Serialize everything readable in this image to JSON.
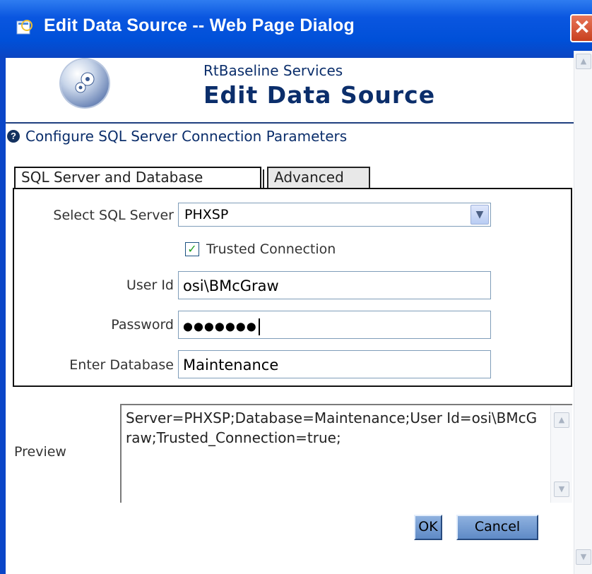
{
  "window": {
    "title": "Edit Data Source -- Web Page Dialog",
    "close_symbol": "✕"
  },
  "header": {
    "service_name": "RtBaseline Services",
    "heading": "Edit Data Source",
    "logo_icon": "gears-icon"
  },
  "section": {
    "help_symbol": "?",
    "title": "Configure SQL Server Connection Parameters"
  },
  "tabs": [
    {
      "label": "SQL Server and Database",
      "active": true
    },
    {
      "label": "Advanced",
      "active": false
    }
  ],
  "form": {
    "server_label": "Select SQL Server",
    "server_value": "PHXSP",
    "trusted_label": "Trusted Connection",
    "trusted_checked": true,
    "userid_label": "User Id",
    "userid_value": "osi\\BMcGraw",
    "password_label": "Password",
    "password_value": "●●●●●●●",
    "database_label": "Enter Database",
    "database_value": "Maintenance"
  },
  "preview": {
    "label": "Preview",
    "text": "Server=PHXSP;Database=Maintenance;User Id=osi\\BMcGraw;Trusted_Connection=true;"
  },
  "buttons": {
    "ok": "OK",
    "cancel": "Cancel"
  },
  "colors": {
    "titlebar": "#0050d8",
    "heading_text": "#0b2e6b",
    "button": "#6f96cf"
  }
}
